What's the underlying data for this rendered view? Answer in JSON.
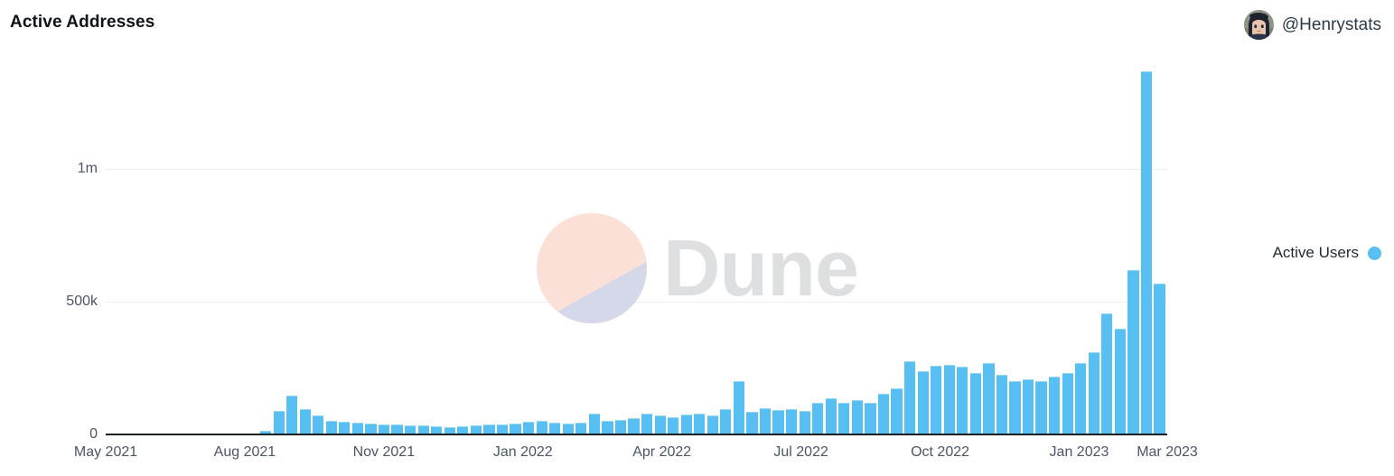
{
  "header": {
    "title": "Active Addresses",
    "handle": "@Henrystats",
    "avatar_icon": "user-avatar-icon"
  },
  "legend": {
    "label": "Active Users",
    "color": "#58bff2",
    "position": "right"
  },
  "watermark": {
    "text": "Dune",
    "mark_icon": "dune-logo-icon",
    "color": "#dedfe0",
    "mark_top_color": "#fbe0d8",
    "mark_bottom_color": "#d5d8e8"
  },
  "chart_data": {
    "type": "bar",
    "title": "Active Addresses",
    "xlabel": "",
    "ylabel": "",
    "ylim": [
      0,
      1400000
    ],
    "grid": true,
    "gridlines": [
      0,
      500000,
      1000000
    ],
    "ytick_labels": [
      "0",
      "500k",
      "1m"
    ],
    "ytick_values": [
      0,
      500000,
      1000000
    ],
    "xtick_labels": [
      "May 2021",
      "Aug 2021",
      "Nov 2021",
      "Jan 2022",
      "Apr 2022",
      "Jul 2022",
      "Oct 2022",
      "Jan 2023",
      "Mar 2023"
    ],
    "xtick_positions": [
      0,
      0.131,
      0.262,
      0.393,
      0.524,
      0.655,
      0.786,
      0.917,
      1.0
    ],
    "series": [
      {
        "name": "Active Users",
        "color": "#58bff2",
        "bar_start_fraction": 0.1455,
        "values": [
          12000,
          88000,
          145000,
          95000,
          70000,
          52000,
          48000,
          44000,
          40000,
          38000,
          36000,
          34000,
          33000,
          30000,
          29000,
          32000,
          34000,
          36000,
          38000,
          42000,
          47000,
          52000,
          45000,
          40000,
          43000,
          80000,
          50000,
          55000,
          62000,
          78000,
          70000,
          66000,
          74000,
          78000,
          72000,
          95000,
          200000,
          86000,
          100000,
          92000,
          95000,
          90000,
          118000,
          138000,
          120000,
          128000,
          118000,
          152000,
          175000,
          275000,
          240000,
          260000,
          262000,
          255000,
          232000,
          268000,
          225000,
          200000,
          208000,
          200000,
          218000,
          232000,
          268000,
          310000,
          455000,
          398000,
          620000,
          1370000,
          570000
        ]
      }
    ]
  }
}
